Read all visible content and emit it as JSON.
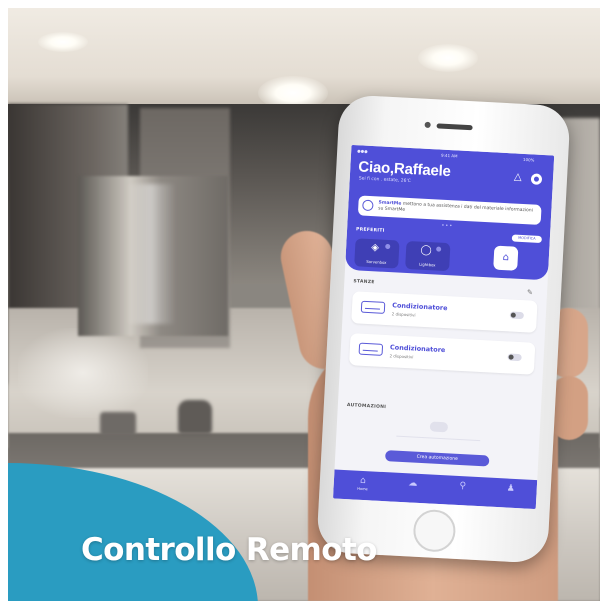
{
  "caption": {
    "title": "Controllo Remoto",
    "accent_color": "#2a9cc1"
  },
  "app": {
    "accent_color": "#4f4fd8",
    "status_bar": {
      "time": "9:41 AM",
      "battery": "100%"
    },
    "greeting": "Ciao,Raffaele",
    "subtitle": "Sei fi con . estate, 26'C",
    "notification_icon": "bell-icon",
    "settings_icon": "gear-icon",
    "banner": {
      "highlight": "SmartMe",
      "text": "mettono a tua assistenza i dati del materiale informazioni su SmartMe"
    },
    "favorites": {
      "label": "PREFERITI",
      "action": "MODIFICA",
      "items": [
        {
          "label": "Sorvenbox",
          "icon": "outlet-icon"
        },
        {
          "label": "Lightbox",
          "icon": "bulb-icon"
        },
        {
          "label": "",
          "icon": "home-add-icon"
        }
      ]
    },
    "rooms": {
      "label": "STANZE",
      "devices": [
        {
          "name": "Condizionatore",
          "detail": "2 dispositivi"
        },
        {
          "name": "Condizionatore",
          "detail": "2 dispositivi"
        }
      ]
    },
    "automations": {
      "label": "AUTOMAZIONI",
      "button": "Crea automazione"
    },
    "tabs": [
      {
        "label": "Home",
        "icon": "home-icon"
      },
      {
        "label": "",
        "icon": "cloud-icon"
      },
      {
        "label": "",
        "icon": "location-icon"
      },
      {
        "label": "",
        "icon": "user-icon"
      }
    ]
  }
}
